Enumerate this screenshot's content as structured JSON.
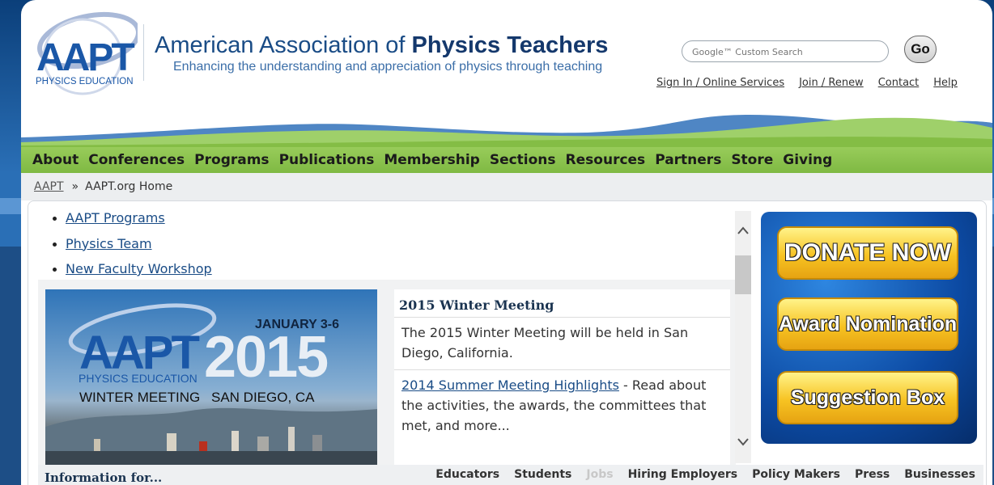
{
  "header": {
    "logo_text": "AAPT",
    "logo_subtext": "PHYSICS EDUCATION",
    "org_name_prefix": "American Association of ",
    "org_name_bold": "Physics Teachers",
    "tagline": "Enhancing the understanding and appreciation of physics through teaching"
  },
  "search": {
    "placeholder": "Google™ Custom Search",
    "go_label": "Go"
  },
  "util_links": [
    "Sign In / Online Services",
    "Join / Renew",
    "Contact",
    "Help"
  ],
  "nav": [
    "About",
    "Conferences",
    "Programs",
    "Publications",
    "Membership",
    "Sections",
    "Resources",
    "Partners",
    "Store",
    "Giving"
  ],
  "breadcrumb": {
    "root": "AAPT",
    "separator": "»",
    "current": "AAPT.org Home"
  },
  "bullets": [
    "AAPT Programs",
    "Physics Team",
    "New Faculty Workshop"
  ],
  "promo": {
    "logo_text": "AAPT",
    "logo_subtext": "PHYSICS EDUCATION",
    "year": "2015",
    "dates": "JANUARY 3-6",
    "event": "WINTER MEETING",
    "location": "SAN DIEGO, CA"
  },
  "news": {
    "title": "2015 Winter Meeting",
    "item1": "The 2015 Winter Meeting will be held in San Diego, California.",
    "item2_link": "2014 Summer Meeting Highlights",
    "item2_text": " - Read about the activities, the awards, the committees that met, and more..."
  },
  "donate_buttons": [
    "DONATE NOW",
    "Award Nomination",
    "Suggestion Box"
  ],
  "info_bar": {
    "title": "Information for...",
    "links": [
      "Educators",
      "Students",
      "Jobs",
      "Hiring Employers",
      "Policy Makers",
      "Press",
      "Businesses"
    ]
  },
  "colors": {
    "nav_green": "#8cc24e",
    "brand_blue": "#1a57a7",
    "donate_gold": "#f7c322"
  }
}
